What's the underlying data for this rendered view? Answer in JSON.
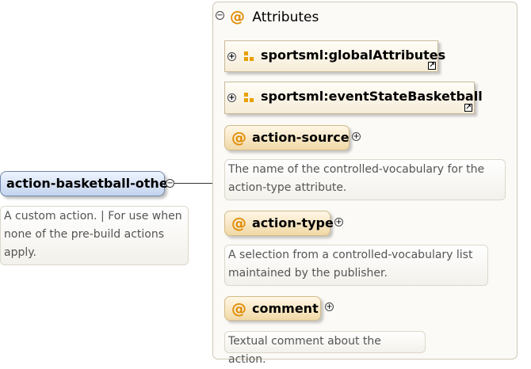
{
  "root": {
    "label": "action-basketball-other",
    "documentation": "A custom action. | For use when none of the pre-build actions apply.",
    "toggle": "−"
  },
  "attributes_group": {
    "title": "Attributes",
    "toggle": "−",
    "refs": [
      {
        "label": "sportsml:globalAttributes",
        "toggle": "+",
        "icon": "attribute-group-icon"
      },
      {
        "label": "sportsml:eventStateBasketball",
        "toggle": "+",
        "icon": "attribute-group-icon"
      }
    ],
    "attributes": [
      {
        "label": "action-source",
        "toggle": "+",
        "documentation": "The name of the controlled-vocabulary for the action-type attribute."
      },
      {
        "label": "action-type",
        "toggle": "+",
        "documentation": "A selection from a controlled-vocabulary list maintained by the publisher."
      },
      {
        "label": "comment",
        "toggle": "+",
        "documentation": "Textual comment about the action."
      }
    ]
  },
  "symbols": {
    "attribute": "@",
    "shortcut": "↗"
  }
}
